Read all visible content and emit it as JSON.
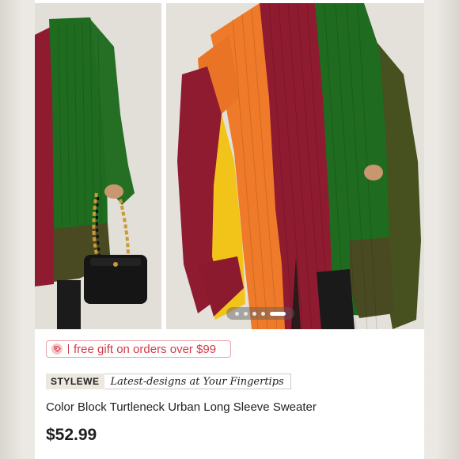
{
  "carousel": {
    "image_count": 5,
    "active_index": 4,
    "images": [
      {
        "alt": "Color Block Turtleneck Urban Long Sleeve Sweater - side"
      },
      {
        "alt": "Color Block Turtleneck Urban Long Sleeve Sweater - front"
      }
    ]
  },
  "promo": {
    "icon": "gift-tag-icon",
    "text": "free gift on orders over $99"
  },
  "brand": {
    "logo_text": "STYLEWE",
    "tagline": "Latest-designs at Your Fingertips"
  },
  "product": {
    "title": "Color Block Turtleneck Urban Long Sleeve Sweater",
    "price": "$52.99"
  },
  "colors": {
    "accent": "#d23a47",
    "burgundy": "#8e1b30",
    "green": "#1f6b1f",
    "olive": "#4a4a22",
    "orange": "#ef7a2a",
    "yellow": "#f2c419"
  }
}
